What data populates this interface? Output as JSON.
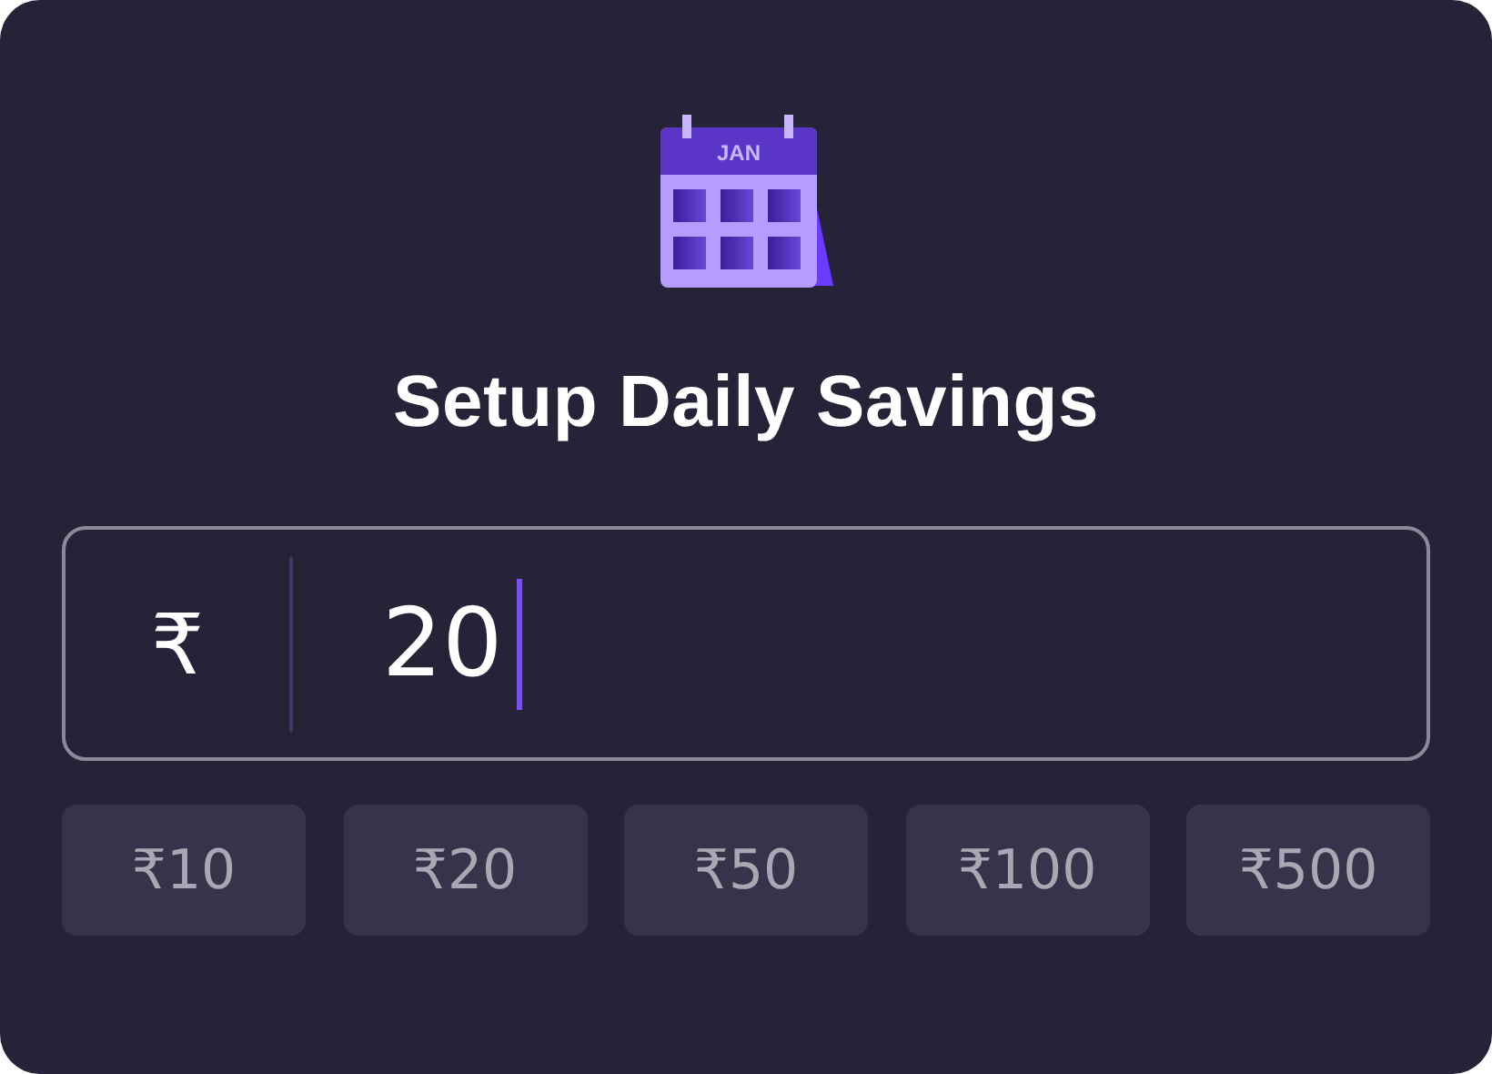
{
  "calendar_icon": {
    "month": "JAN"
  },
  "title": "Setup Daily Savings",
  "amount_field": {
    "currency": "₹",
    "value": "20"
  },
  "quick_amounts": [
    "₹10",
    "₹20",
    "₹50",
    "₹100",
    "₹500"
  ]
}
